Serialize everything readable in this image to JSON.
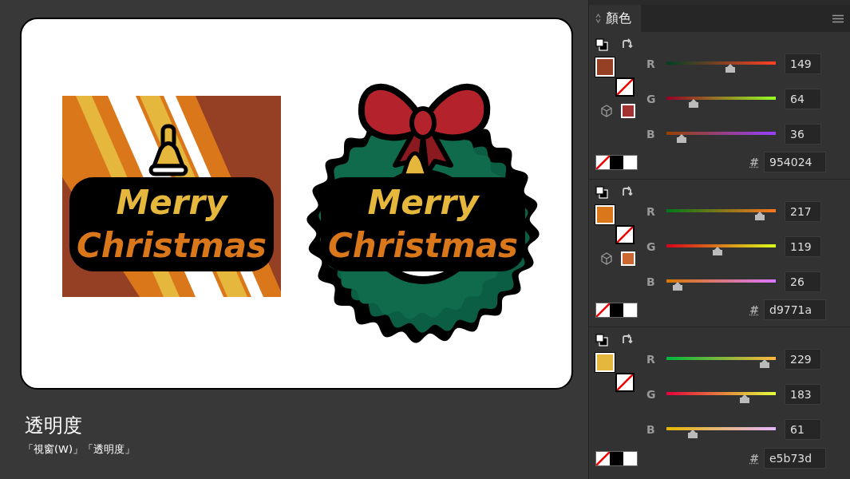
{
  "artwork": {
    "poster": {
      "lines": [
        "Merry",
        "Christmas"
      ]
    },
    "wreath": {
      "lines": [
        "Merry",
        "Christmas"
      ]
    }
  },
  "caption": {
    "title": "透明度",
    "subtitle": "「視窗(W)」「透明度」"
  },
  "panel": {
    "title": "顏色"
  },
  "colors": [
    {
      "color": "#954024",
      "websafe": {
        "color": "#a33333"
      },
      "channels": [
        {
          "label": "R",
          "value": "149",
          "level": 0.584
        },
        {
          "label": "G",
          "value": "64",
          "level": 0.251
        },
        {
          "label": "B",
          "value": "36",
          "level": 0.141
        }
      ],
      "hash": "#",
      "hex": "954024"
    },
    {
      "color": "#d9771a",
      "websafe": {
        "color": "#cc6633"
      },
      "channels": [
        {
          "label": "R",
          "value": "217",
          "level": 0.851
        },
        {
          "label": "G",
          "value": "119",
          "level": 0.467
        },
        {
          "label": "B",
          "value": "26",
          "level": 0.102
        }
      ],
      "hash": "#",
      "hex": "d9771a"
    },
    {
      "color": "#e5b73d",
      "channels": [
        {
          "label": "R",
          "value": "229",
          "level": 0.898
        },
        {
          "label": "G",
          "value": "183",
          "level": 0.718
        },
        {
          "label": "B",
          "value": "61",
          "level": 0.239
        }
      ],
      "hash": "#",
      "hex": "e5b73d"
    }
  ]
}
